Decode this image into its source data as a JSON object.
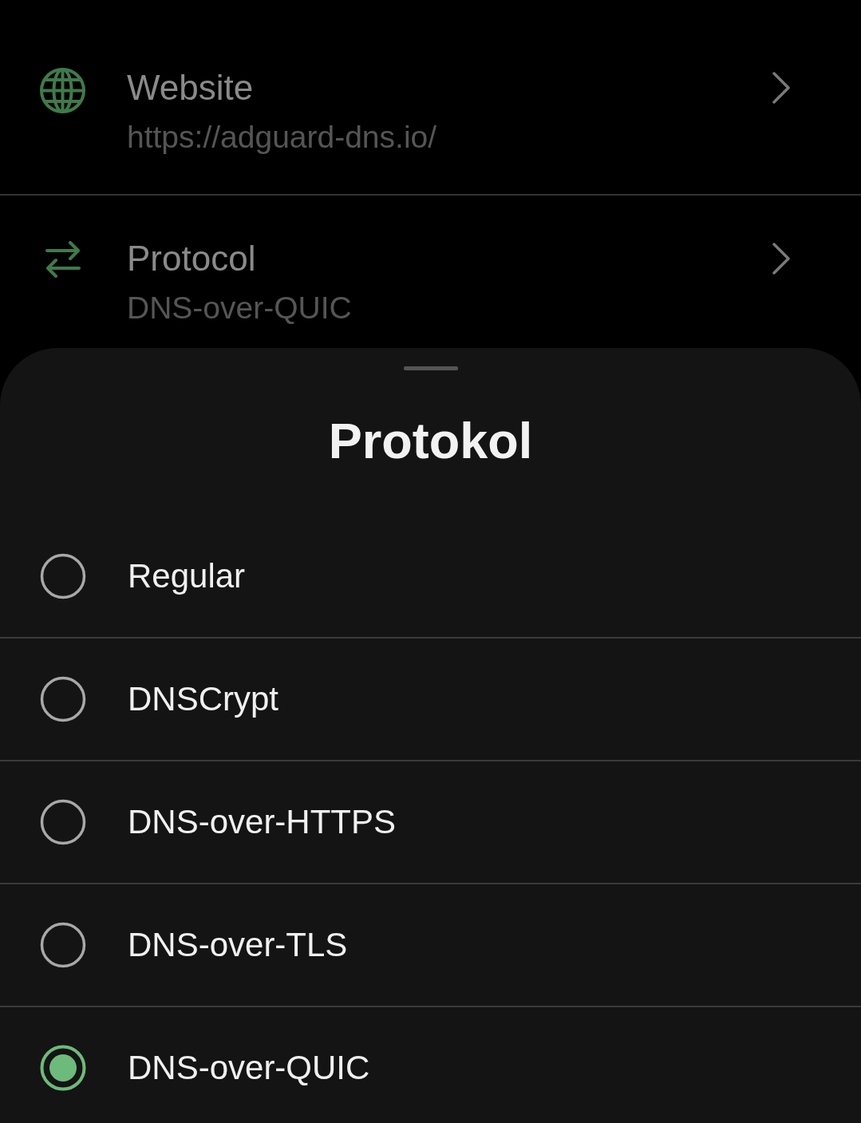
{
  "settings": [
    {
      "kind": "website",
      "title": "Website",
      "subtitle": "https://adguard-dns.io/"
    },
    {
      "kind": "protocol",
      "title": "Protocol",
      "subtitle": "DNS-over-QUIC"
    }
  ],
  "sheet": {
    "title": "Protokol",
    "options": [
      {
        "label": "Regular",
        "selected": false
      },
      {
        "label": "DNSCrypt",
        "selected": false
      },
      {
        "label": "DNS-over-HTTPS",
        "selected": false
      },
      {
        "label": "DNS-over-TLS",
        "selected": false
      },
      {
        "label": "DNS-over-QUIC",
        "selected": true
      }
    ]
  }
}
